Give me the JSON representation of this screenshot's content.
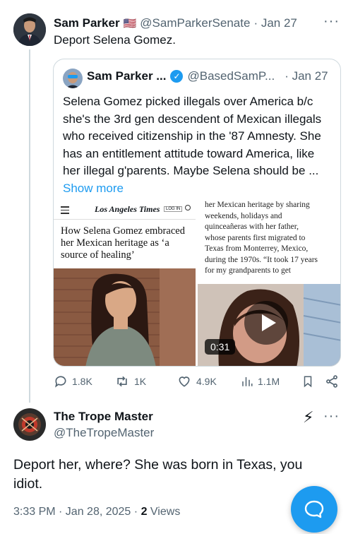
{
  "tweet": {
    "author_name": "Sam Parker",
    "flag": "🇺🇸",
    "handle": "@SamParkerSenate",
    "date": "· Jan 27",
    "text": "Deport Selena Gomez.",
    "quote": {
      "author_name": "Sam Parker ...",
      "handle": "@BasedSamP...",
      "date": "· Jan 27",
      "text_lines": [
        "Selena Gomez picked illegals over America b/c",
        "she's the 3rd gen descendent of Mexican illegals",
        "who received citizenship in the '87 Amnesty. She",
        "has an entitlement attitude toward America, like",
        "her illegal g'parents. Maybe Selena should be ..."
      ],
      "show_more": "Show more",
      "article": {
        "masthead": "Los Angeles Times",
        "login": "LOG IN",
        "headline_lines": [
          "How Selena Gomez embraced",
          "her Mexican heritage as ‘a",
          "source of healing’"
        ],
        "excerpt_lines": [
          "her Mexican heritage by sharing",
          "weekends, holidays and",
          "quinceañeras with her father,",
          "whose parents first migrated to",
          "Texas from Monterrey, Mexico,",
          "during the 1970s. “It took 17 years",
          "for my grandparents to get"
        ]
      },
      "video_duration": "0:31"
    },
    "stats": {
      "replies": "1.8K",
      "reposts": "1K",
      "likes": "4.9K",
      "views": "1.1M"
    }
  },
  "reply": {
    "author_name": "The Trope Master",
    "handle": "@TheTropeMaster",
    "text_lines": [
      "Deport her, where?  She was born in Texas, you",
      "idiot."
    ],
    "timestamp": "3:33 PM · Jan 28, 2025 ·",
    "views_count": "2",
    "views_label": "Views"
  },
  "colors": {
    "accent": "#1d9bf0",
    "muted": "#536471",
    "border": "#cfd9de"
  }
}
